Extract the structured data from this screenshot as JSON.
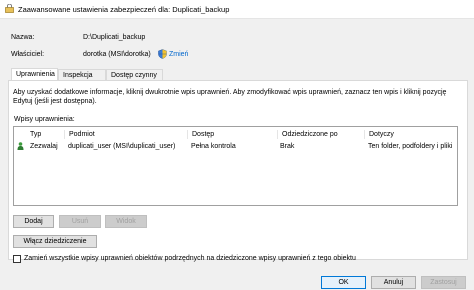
{
  "window": {
    "title": "Zaawansowane ustawienia zabezpieczeń dla: Duplicati_backup"
  },
  "details": {
    "name_label": "Nazwa:",
    "name_value": "D:\\Duplicati_backup",
    "owner_label": "Właściciel:",
    "owner_value": "dorotka (MSI\\dorotka)",
    "change_link": "Zmień"
  },
  "tabs": [
    {
      "label": "Uprawnienia",
      "active": true
    },
    {
      "label": "Inspekcja",
      "active": false
    },
    {
      "label": "Dostęp czynny",
      "active": false
    }
  ],
  "info": {
    "line1": "Aby uzyskać dodatkowe informacje, kliknij dwukrotnie wpis uprawnień. Aby zmodyfikować wpis uprawnień, zaznacz ten wpis i kliknij pozycję",
    "line2": "Edytuj (jeśli jest dostępna)."
  },
  "entries": {
    "label": "Wpisy uprawnienia:",
    "columns": [
      "Typ",
      "Podmiot",
      "Dostęp",
      "Odziedziczone po",
      "Dotyczy"
    ],
    "rows": [
      {
        "type": "Zezwalaj",
        "principal": "duplicati_user (MSI\\duplicati_user)",
        "access": "Pełna kontrola",
        "inherited": "Brak",
        "applies": "Ten folder, podfoldery i pliki"
      }
    ]
  },
  "buttons": {
    "add": "Dodaj",
    "remove": "Usuń",
    "view": "Widok",
    "enable_inheritance": "Włącz dziedziczenie",
    "ok": "OK",
    "cancel": "Anuluj",
    "apply": "Zastosuj"
  },
  "replace_checkbox": {
    "label": "Zamień wszystkie wpisy uprawnień obiektów podrzędnych na dziedziczone wpisy uprawnień z tego obiektu",
    "checked": false
  },
  "icons": {
    "window": "lock-folder-icon",
    "shield": "uac-shield-icon",
    "user": "user-icon"
  }
}
